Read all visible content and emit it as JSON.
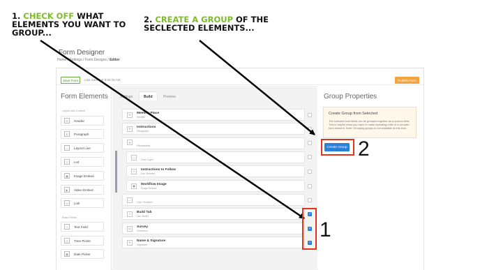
{
  "annotations": {
    "step1": {
      "num": "1.",
      "highlight": "CHECK OFF",
      "rest1": "WHAT",
      "line2": "ELEMENTS YOU WANT TO",
      "line3": "GROUP..."
    },
    "step2": {
      "num": "2.",
      "highlight": "CREATE A GROUP",
      "rest1": "OF THE",
      "line2": "SECLECTED ELEMENTS..."
    },
    "big1": "1",
    "big2": "2",
    "highlight_color": "#7dbb2d",
    "box_color": "#e0341b"
  },
  "page": {
    "title": "Form Designer",
    "breadcrumbs": [
      "Home",
      "Settings",
      "Form Designs",
      "Editor"
    ]
  },
  "toolbar": {
    "save_label": "Save Form",
    "last_saved": "Last Saved at 9:04:15 AM",
    "publish_label": "Publish Form"
  },
  "left_panel": {
    "title": "Form Elements",
    "layout_section": "Layout and Content",
    "layout_items": [
      {
        "label": "Header",
        "icon": "header-icon"
      },
      {
        "label": "Paragraph",
        "icon": "paragraph-icon"
      },
      {
        "label": "Layout Line",
        "icon": "line-icon"
      },
      {
        "label": "List",
        "icon": "list-icon"
      },
      {
        "label": "Image Embed",
        "icon": "image-icon"
      },
      {
        "label": "Video Embed",
        "icon": "video-icon"
      },
      {
        "label": "Link",
        "icon": "link-icon"
      }
    ],
    "basic_section": "Basic Fields",
    "basic_items": [
      {
        "label": "Text Field",
        "icon": "text-field-icon"
      },
      {
        "label": "Time Picker",
        "icon": "clock-icon"
      },
      {
        "label": "Date Picker",
        "icon": "calendar-icon"
      }
    ]
  },
  "tabs": [
    {
      "label": "Settings",
      "active": false
    },
    {
      "label": "Build",
      "active": true
    },
    {
      "label": "Preview",
      "active": false
    }
  ],
  "rows": [
    {
      "title": "Meeting Place",
      "sub": "Header",
      "checked": false
    },
    {
      "title": "Instructions",
      "sub": "Paragraph",
      "checked": false
    },
    {
      "title": "",
      "sub": "Repeatable",
      "checked": false
    },
    {
      "title": "",
      "sub": "Line: Light",
      "checked": false
    },
    {
      "title": "Instructions to Follow",
      "sub": "List: Number",
      "checked": false
    },
    {
      "title": "Workflow Image",
      "sub": "Image Embed",
      "checked": false
    },
    {
      "title": "",
      "sub": "Line: Medium",
      "checked": false
    },
    {
      "title": "Build Tab",
      "sub": "List: Bullet",
      "checked": true
    },
    {
      "title": "Survey",
      "sub": "Checkbox",
      "checked": true
    },
    {
      "title": "Name & Signature",
      "sub": "Signature",
      "checked": true
    }
  ],
  "right_panel": {
    "title": "Group Properties",
    "box_heading": "Create Group from Selected",
    "box_text": "The selected form fields can be grouped together as a custom field. This is helpful when you have to make repeating units of a complex form element. Note: Grouping groups is not available at this time.",
    "create_label": "Create Group"
  }
}
